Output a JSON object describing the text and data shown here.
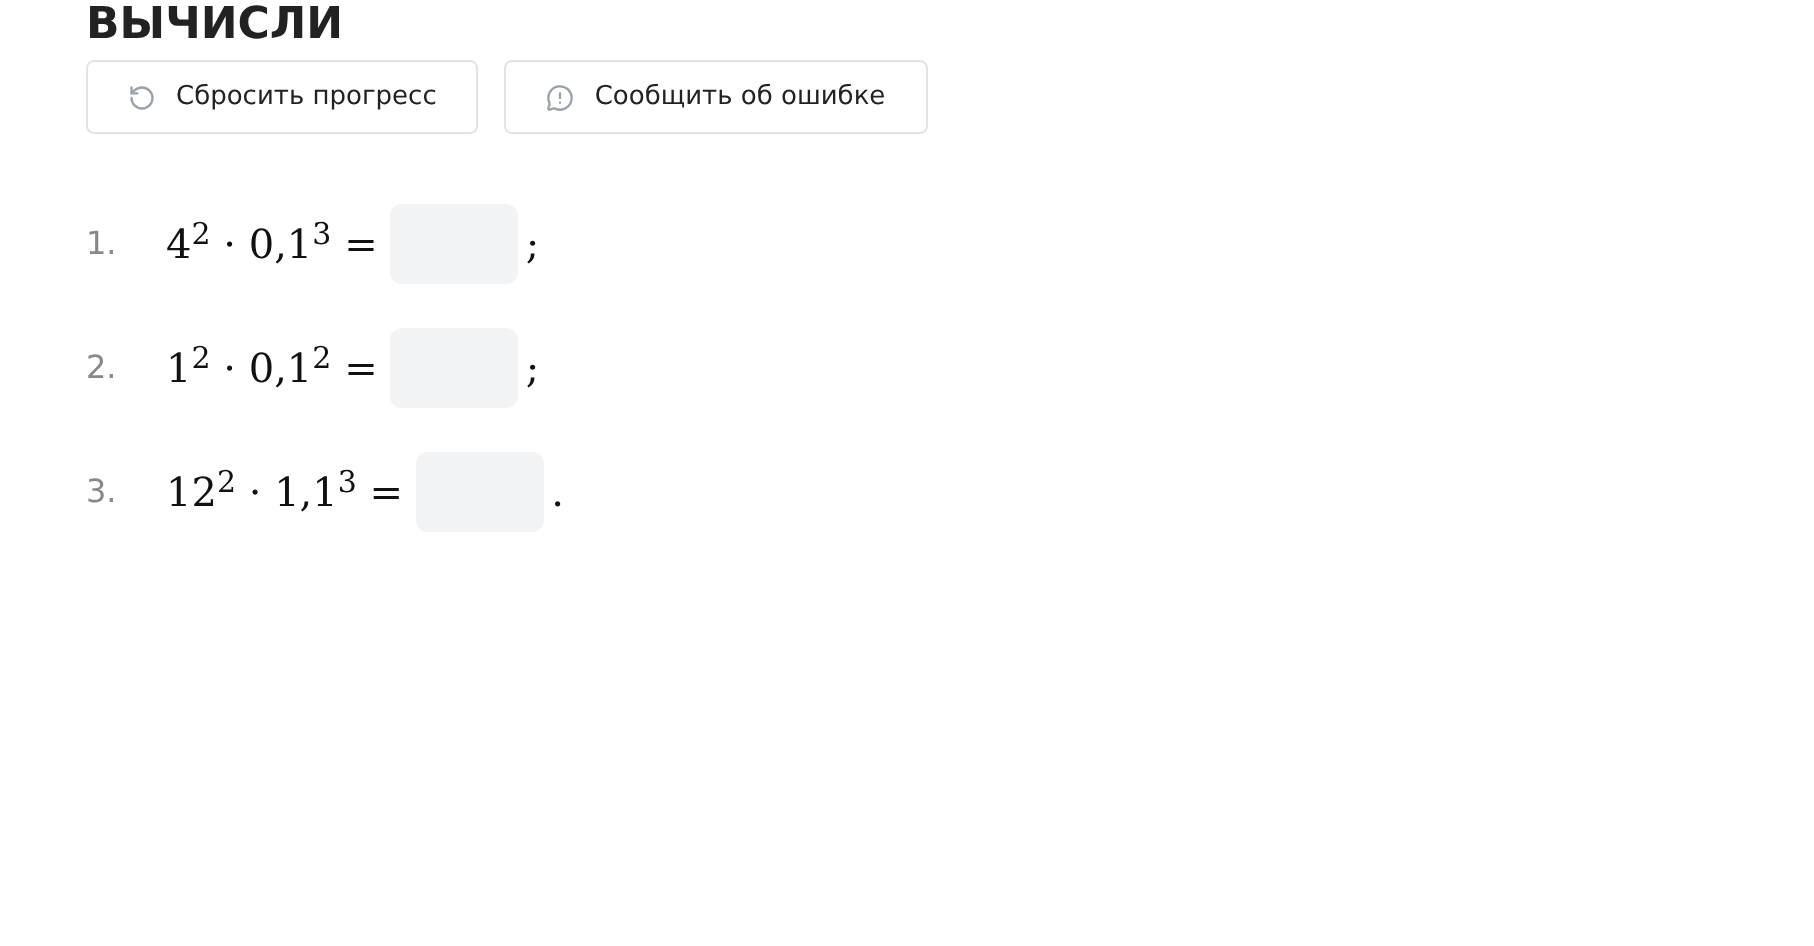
{
  "heading": "ВЫЧИСЛИ",
  "buttons": [
    {
      "kind": "reset",
      "label": "Сбросить прогресс"
    },
    {
      "kind": "report",
      "label": "Сообщить об ошибке"
    }
  ],
  "tasks": [
    {
      "number": "1.",
      "expression": "4$^{2}$ · 0,1$^{3}$ =",
      "punctuation": ";"
    },
    {
      "number": "2.",
      "expression": "1$^{2}$ · 0,1$^{2}$ =",
      "punctuation": ";"
    },
    {
      "number": "3.",
      "expression": "12$^{2}$ · 1,1$^{3}$ =",
      "punctuation": "."
    }
  ]
}
